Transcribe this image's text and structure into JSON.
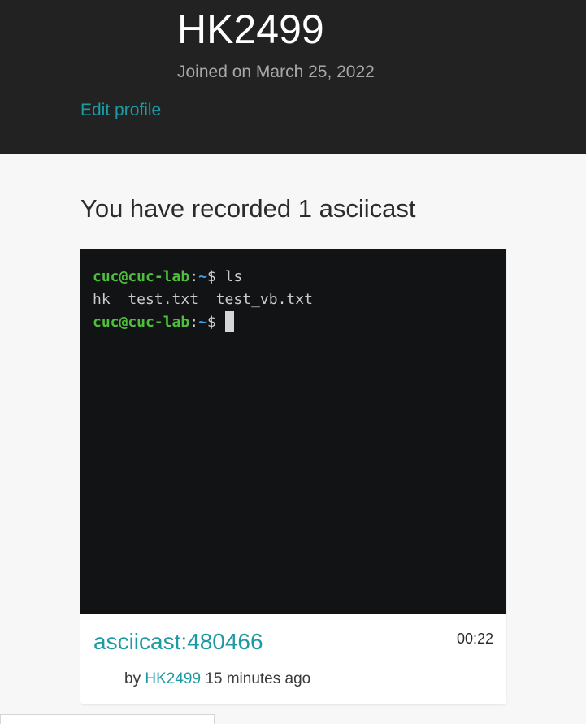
{
  "profile": {
    "username": "HK2499",
    "joined": "Joined on March 25, 2022",
    "edit_label": "Edit profile"
  },
  "recordings": {
    "heading": "You have recorded 1 asciicast",
    "items": [
      {
        "terminal_lines": [
          {
            "user_host": "cuc@cuc-lab",
            "colon": ":",
            "path": "~",
            "prompt": "$",
            "command": " ls"
          },
          {
            "output": "hk  test.txt  test_vb.txt"
          },
          {
            "user_host": "cuc@cuc-lab",
            "colon": ":",
            "path": "~",
            "prompt": "$",
            "command": " "
          }
        ],
        "title": "asciicast:480466",
        "duration": "00:22",
        "by_label": "by",
        "author": "HK2499",
        "time_ago": "15 minutes ago"
      }
    ]
  },
  "colors": {
    "header_bg": "#222222",
    "accent": "#1d9aa3",
    "terminal_bg": "#121314",
    "prompt_user": "#4ebf3a",
    "prompt_path": "#3a9ee3"
  }
}
